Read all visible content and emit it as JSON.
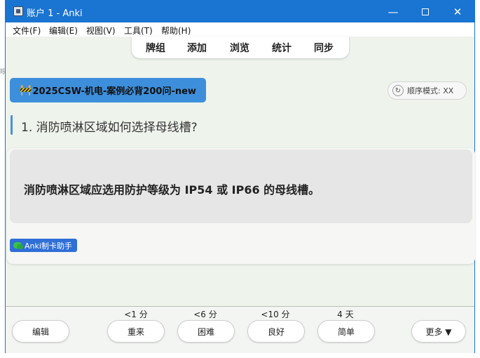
{
  "window": {
    "title": "账户 1 - Anki",
    "minimize_glyph": "—",
    "close_glyph": "✕"
  },
  "menu": [
    {
      "label": "文件(F)"
    },
    {
      "label": "编辑(E)"
    },
    {
      "label": "视图(V)"
    },
    {
      "label": "工具(T)"
    },
    {
      "label": "帮助(H)"
    }
  ],
  "toolbar": {
    "decks": "牌组",
    "add": "添加",
    "browse": "浏览",
    "stats": "统计",
    "sync": "同步"
  },
  "deck": {
    "emoji": "🚧",
    "name": "2025CSW-机电-案例必背200问-new"
  },
  "order": {
    "icon": "↻",
    "label": "顺序模式: XX"
  },
  "card": {
    "question": "1. 消防喷淋区域如何选择母线槽?",
    "answer": "消防喷淋区域应选用防护等级为 IP54 或 IP66 的母线槽。"
  },
  "badge": {
    "label": "Anki制卡助手"
  },
  "bottom": {
    "edit": "编辑",
    "more": "更多 ▼",
    "answers": [
      {
        "interval": "<1 分",
        "label": "重来"
      },
      {
        "interval": "<6 分",
        "label": "困难"
      },
      {
        "interval": "<10 分",
        "label": "良好"
      },
      {
        "interval": "4 天",
        "label": "简单"
      }
    ]
  },
  "edge_text": "眼"
}
